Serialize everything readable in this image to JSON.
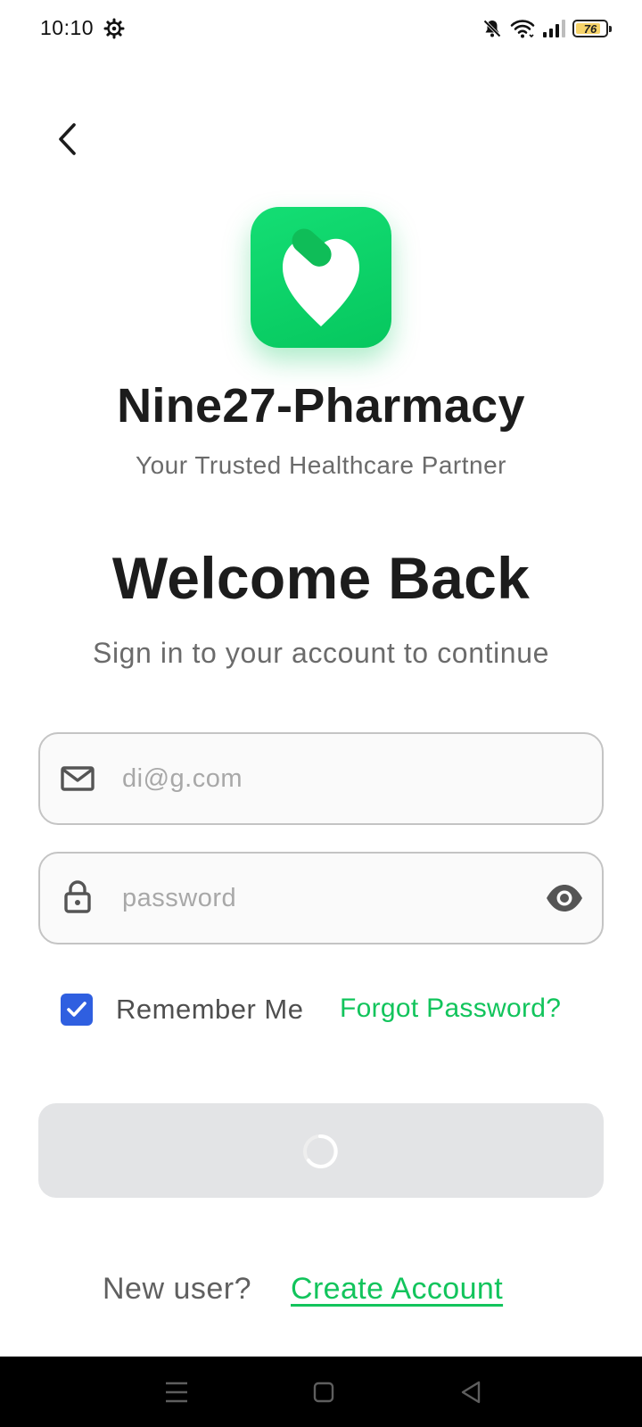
{
  "status_bar": {
    "time": "10:10",
    "battery_level": "76",
    "icons": [
      "gear-icon",
      "bell-off-icon",
      "wifi-icon",
      "signal-icon",
      "battery-icon"
    ]
  },
  "header": {
    "back_icon": "chevron-left-icon"
  },
  "brand": {
    "app_name": "Nine27-Pharmacy",
    "tagline": "Your Trusted Healthcare Partner",
    "accent_color": "#12c45c"
  },
  "login": {
    "title": "Welcome Back",
    "subtitle": "Sign in to your account to continue",
    "email": {
      "value": "",
      "placeholder": "di@g.com",
      "icon": "mail-icon"
    },
    "password": {
      "value": "",
      "placeholder": "password",
      "icon": "lock-icon",
      "toggle_icon": "eye-icon"
    },
    "remember_me": {
      "label": "Remember Me",
      "checked": true,
      "color": "#2f5fe0"
    },
    "forgot_password": "Forgot Password?",
    "submit": {
      "state": "loading",
      "icon": "spinner-icon"
    }
  },
  "footer": {
    "prompt": "New user?",
    "create_account": "Create Account"
  },
  "nav_bar": {
    "icons": [
      "menu-icon",
      "home-icon",
      "back-triangle-icon"
    ]
  }
}
